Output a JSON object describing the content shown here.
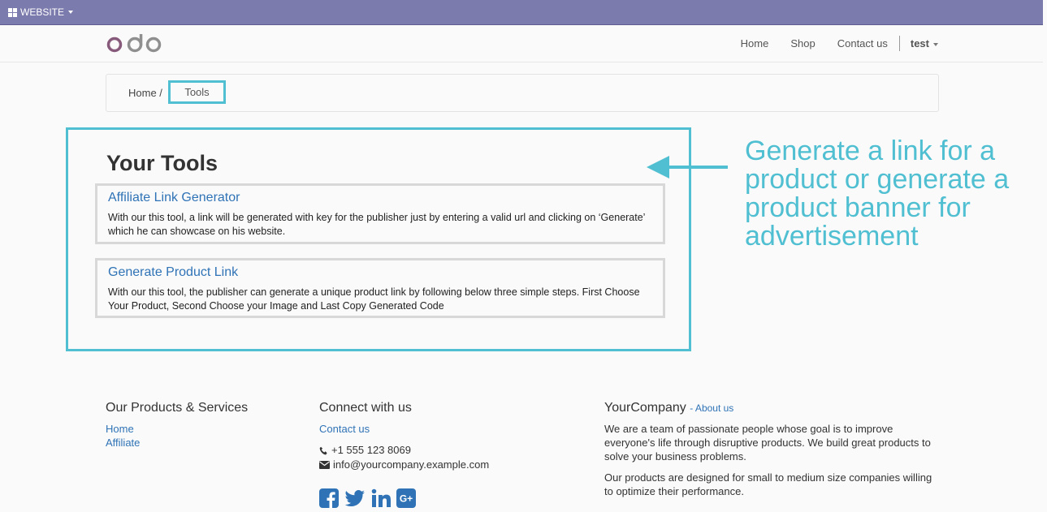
{
  "adminbar": {
    "menu_label": "WEBSITE"
  },
  "brand": {
    "logo_text": "odoo",
    "accent": "#875a7b",
    "logo_gray": "#8f8f8f"
  },
  "nav": {
    "links": [
      "Home",
      "Shop",
      "Contact us"
    ],
    "user": "test"
  },
  "breadcrumb": {
    "home": "Home /",
    "current": "Tools"
  },
  "main": {
    "title": "Your Tools",
    "tools": [
      {
        "title": "Affiliate Link Generator",
        "description": "With our this tool, a link will be generated with key for the publisher just by entering a valid url and clicking on ‘Generate’ which he can showcase on his website."
      },
      {
        "title": "Generate Product Link",
        "description": "With our this tool, the publisher can generate a unique product link by following below three simple steps. First Choose Your Product, Second Choose your Image and Last Copy Generated Code"
      }
    ]
  },
  "annotation": {
    "text": "Generate a link for a product or generate a product banner for advertisement",
    "color": "#4fbfd1"
  },
  "footer": {
    "products": {
      "heading": "Our Products & Services",
      "links": [
        "Home",
        "Affiliate"
      ]
    },
    "connect": {
      "heading": "Connect with us",
      "link": "Contact us",
      "phone": "+1 555 123 8069",
      "email": "info@yourcompany.example.com",
      "social_icons": [
        "facebook-icon",
        "twitter-icon",
        "linkedin-icon",
        "google-plus-icon"
      ]
    },
    "company": {
      "name": "YourCompany",
      "about_link": "- About us",
      "para1": "We are a team of passionate people whose goal is to improve everyone's life through disruptive products. We build great products to solve your business problems.",
      "para2": "Our products are designed for small to medium size companies willing to optimize their performance."
    }
  },
  "colors": {
    "link": "#2f73b6",
    "adminbar": "#7c7bad",
    "highlight": "#4fbfd1"
  }
}
